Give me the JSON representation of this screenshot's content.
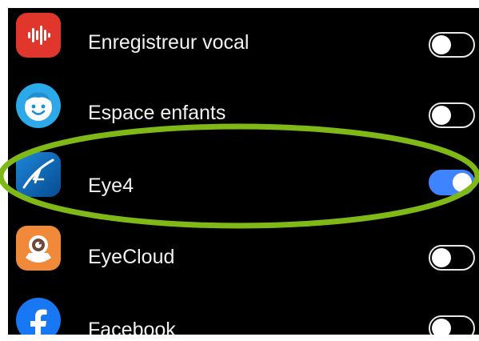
{
  "apps": [
    {
      "label": "Enregistreur vocal",
      "icon": "voice-recorder-icon",
      "enabled": false,
      "icon_color": "#e0362b"
    },
    {
      "label": "Espace enfants",
      "icon": "kids-space-icon",
      "enabled": false,
      "icon_color": "#2da8e8"
    },
    {
      "label": "Eye4",
      "icon": "eye4-app-icon",
      "enabled": true,
      "icon_color": "#0b6fbf"
    },
    {
      "label": "EyeCloud",
      "icon": "eyecloud-app-icon",
      "enabled": false,
      "icon_color": "#f08a3a"
    },
    {
      "label": "Facebook",
      "icon": "facebook-icon",
      "enabled": false,
      "icon_color": "#1877f2"
    }
  ],
  "colors": {
    "background": "#000000",
    "text": "#f2f2f2",
    "toggle_on": "#3e83ff",
    "highlight": "#7fb817"
  },
  "annotation": {
    "highlighted_item": "Eye4",
    "shape": "ellipse"
  }
}
